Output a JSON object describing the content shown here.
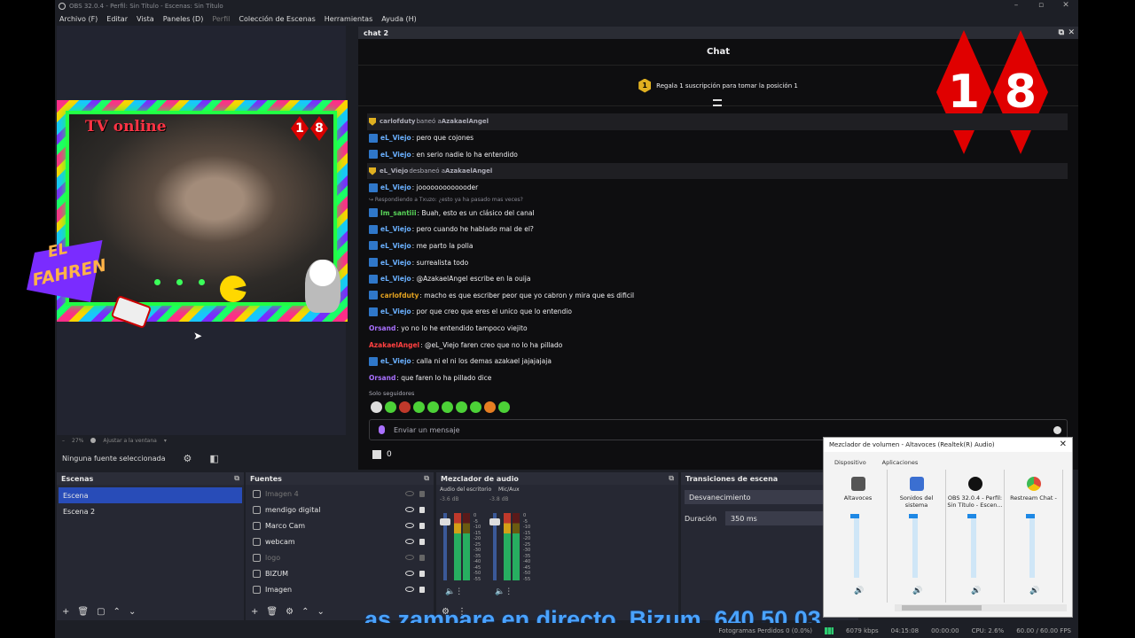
{
  "window": {
    "title": "OBS 32.0.4 - Perfil: Sin Título - Escenas: Sin Título"
  },
  "menu": [
    "Archivo (F)",
    "Editar",
    "Vista",
    "Paneles (D)",
    "Perfil",
    "Colección de Escenas",
    "Herramientas",
    "Ayuda (H)"
  ],
  "preview": {
    "overlay_text": "TV online",
    "badge_digits": [
      "1",
      "8"
    ],
    "brand_line1": "EL",
    "brand_line2": "FAHREN",
    "zoom": "27%",
    "fit_label": "Ajustar a la ventana",
    "no_source": "Ninguna fuente seleccionada"
  },
  "chat": {
    "dock_title": "chat 2",
    "title": "Chat",
    "promo_badge": "1",
    "promo": "Regala 1 suscripción para tomar la posición 1",
    "big_digits": [
      "1",
      "8"
    ],
    "messages": [
      {
        "type": "sys",
        "user": "carlofduty",
        "text": " baneó a ",
        "target": "AzakaelAngel",
        "color": "#adadb8"
      },
      {
        "type": "msg",
        "user": "eL_Viejo",
        "text": ": pero que cojones",
        "color": "#6ab0ff"
      },
      {
        "type": "msg",
        "user": "eL_Viejo",
        "text": ": en serio nadie lo ha entendido",
        "color": "#6ab0ff"
      },
      {
        "type": "sys",
        "user": "eL_Viejo",
        "text": " desbaneó a ",
        "target": "AzakaelAngel",
        "color": "#adadb8"
      },
      {
        "type": "msg",
        "user": "eL_Viejo",
        "text": ": jooooooooooooder",
        "color": "#6ab0ff"
      },
      {
        "type": "hint",
        "text": "Respondiendo a Txuzo: ¿esto ya ha pasado mas veces?"
      },
      {
        "type": "msg",
        "user": "Im_santiii",
        "text": ": Buah, esto es un clásico del canal",
        "color": "#59d659"
      },
      {
        "type": "msg",
        "user": "eL_Viejo",
        "text": ": pero cuando he hablado mal de el?",
        "color": "#6ab0ff"
      },
      {
        "type": "msg",
        "user": "eL_Viejo",
        "text": ": me parto la polla",
        "color": "#6ab0ff"
      },
      {
        "type": "msg",
        "user": "eL_Viejo",
        "text": ": surrealista todo",
        "color": "#6ab0ff"
      },
      {
        "type": "msg",
        "user": "eL_Viejo",
        "text": ": @AzakaelAngel escribe en la ouija",
        "color": "#6ab0ff"
      },
      {
        "type": "msg",
        "user": "carlofduty",
        "text": ": macho es que escriber peor que yo cabron y mira que es dificil",
        "color": "#e0a020"
      },
      {
        "type": "msg",
        "user": "eL_Viejo",
        "text": ": por que creo que eres el unico que lo entendio",
        "color": "#6ab0ff"
      },
      {
        "type": "plain",
        "user": "Orsand",
        "text": ": yo no lo he entendido tampoco viejito",
        "color": "#a970ff"
      },
      {
        "type": "plain",
        "user": "AzakaelAngel",
        "text": ": @eL_Viejo faren creo que no lo ha pillado",
        "color": "#ff4040"
      },
      {
        "type": "msg",
        "user": "eL_Viejo",
        "text": ": calla ni el ni los demas azakael jajajajaja",
        "color": "#6ab0ff"
      },
      {
        "type": "plain",
        "user": "Orsand",
        "text": ": que faren lo ha pillado dice",
        "color": "#a970ff"
      }
    ],
    "followers_only": "Solo seguidores",
    "input_placeholder": "Enviar un mensaje",
    "points": "0"
  },
  "scenes": {
    "title": "Escenas",
    "items": [
      {
        "label": "Escena",
        "active": true
      },
      {
        "label": "Escena 2",
        "active": false
      }
    ]
  },
  "sources": {
    "title": "Fuentes",
    "items": [
      {
        "label": "Imagen 4",
        "visible": false
      },
      {
        "label": "mendigo digital",
        "visible": true
      },
      {
        "label": "Marco Cam",
        "visible": true
      },
      {
        "label": "webcam",
        "visible": true
      },
      {
        "label": "logo",
        "visible": false
      },
      {
        "label": "BIZUM",
        "visible": true
      },
      {
        "label": "Imagen",
        "visible": true
      }
    ]
  },
  "mixer": {
    "title": "Mezclador de audio",
    "channels": [
      {
        "name": "Audio del escritorio",
        "db": "-3.6 dB"
      },
      {
        "name": "Mic/Aux",
        "db": "-3.8 dB"
      }
    ],
    "scale": [
      "0",
      "-5",
      "-10",
      "-15",
      "-20",
      "-25",
      "-30",
      "-35",
      "-40",
      "-45",
      "-50",
      "-55",
      "-60"
    ]
  },
  "transitions": {
    "title": "Transiciones de escena",
    "selected": "Desvanecimiento",
    "duration_label": "Duración",
    "duration": "350 ms"
  },
  "ticker": "as zampare en directo. Bizum. 640 50 03",
  "status": {
    "dropped": "Fotogramas Perdidos 0 (0.0%)",
    "bitrate": "6079 kbps",
    "live_time": "04:15:08",
    "rec_time": "00:00:00",
    "cpu": "CPU: 2.6%",
    "fps": "60.00 / 60.00 FPS"
  },
  "volume_mixer": {
    "title": "Mezclador de volumen - Altavoces (Realtek(R) Audio)",
    "device_label": "Dispositivo",
    "apps_label": "Aplicaciones",
    "columns": [
      {
        "name": "Altavoces",
        "color": "#555"
      },
      {
        "name": "Sonidos del sistema",
        "color": "#3b6fd1"
      },
      {
        "name": "OBS 32.0.4 - Perfil: Sin Título - Escen...",
        "color": "#111"
      },
      {
        "name": "Restream Chat -",
        "color": "#e04a3a"
      }
    ]
  }
}
